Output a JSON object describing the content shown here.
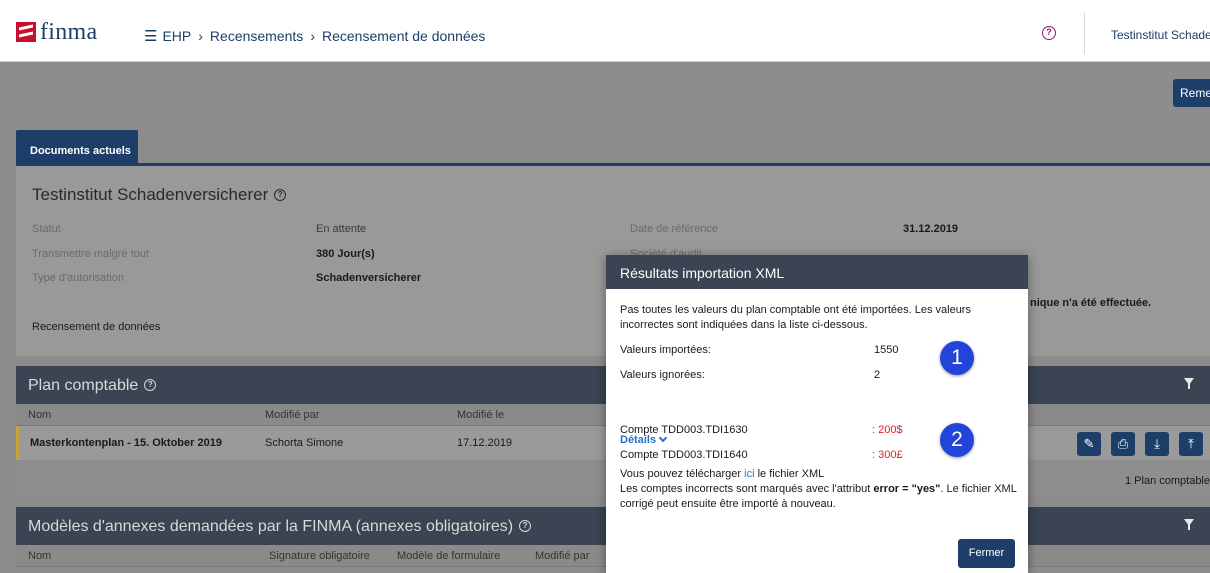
{
  "header": {
    "logo_text": "finma",
    "breadcrumb": [
      "EHP",
      "Recensements",
      "Recensement de données"
    ],
    "help_glyph": "?",
    "user": "Testinstitut Schade"
  },
  "toolbar": {
    "remet_label": "Remet"
  },
  "tabs": [
    {
      "label": "Documents actuels"
    }
  ],
  "institution": {
    "title": "Testinstitut Schadenversicherer",
    "help_glyph": "?",
    "fields": {
      "statut_label": "Statut",
      "statut_value": "En attente",
      "transmettre_label": "Transmettre malgré tout",
      "transmettre_value": "380 Jour(s)",
      "type_label": "Type d'autorisation",
      "type_value": "Schadenversicherer",
      "recensement_label": "Recensement de données",
      "date_label": "Date de référence",
      "date_value": "31.12.2019",
      "audit_label": "Société d'audit",
      "notice": "nique n'a été effectuée."
    }
  },
  "plan_comptable": {
    "title": "Plan comptable",
    "help_glyph": "?",
    "columns": [
      "Nom",
      "Modifié par",
      "Modifié le"
    ],
    "rows": [
      {
        "nom": "Masterkontenplan - 15. Oktober 2019",
        "modifie_par": "Schorta Simone",
        "modifie_le": "17.12.2019"
      }
    ],
    "count": "1 Plan comptable"
  },
  "annexes": {
    "title": "Modèles d'annexes demandées par la FINMA (annexes obligatoires)",
    "help_glyph": "?",
    "columns": [
      "Nom",
      "Signature obligatoire",
      "Modèle de formulaire",
      "Modifié par"
    ]
  },
  "modal": {
    "title": "Résultats importation XML",
    "intro": "Pas toutes les valeurs du plan comptable ont été importées. Les valeurs incorrectes sont indiquées dans la liste ci-dessous.",
    "imported_label": "Valeurs importées:",
    "imported_value": "1550",
    "ignored_label": "Valeurs ignorées:",
    "ignored_value": "2",
    "details_label": "Détails",
    "accounts": [
      {
        "name": "Compte TDD003.TDI1630",
        "value": ": 200$"
      },
      {
        "name": "Compte TDD003.TDI1640",
        "value": ": 300£"
      }
    ],
    "download_prefix": "Vous pouvez télécharger ",
    "download_link": "ici",
    "download_suffix": " le fichier XML",
    "error_text_1": "Les comptes incorrects sont marqués avec l'attribut ",
    "error_attr": "error = \"yes\"",
    "error_text_2": ". Le fichier XML corrigé peut ensuite être importé à nouveau.",
    "close_label": "Fermer"
  },
  "annotations": [
    "1",
    "2"
  ],
  "colors": {
    "brand": "#1d3e68",
    "panel": "#3a4452",
    "error": "#e02020",
    "badge": "#2244d8",
    "link": "#2a73c8"
  }
}
